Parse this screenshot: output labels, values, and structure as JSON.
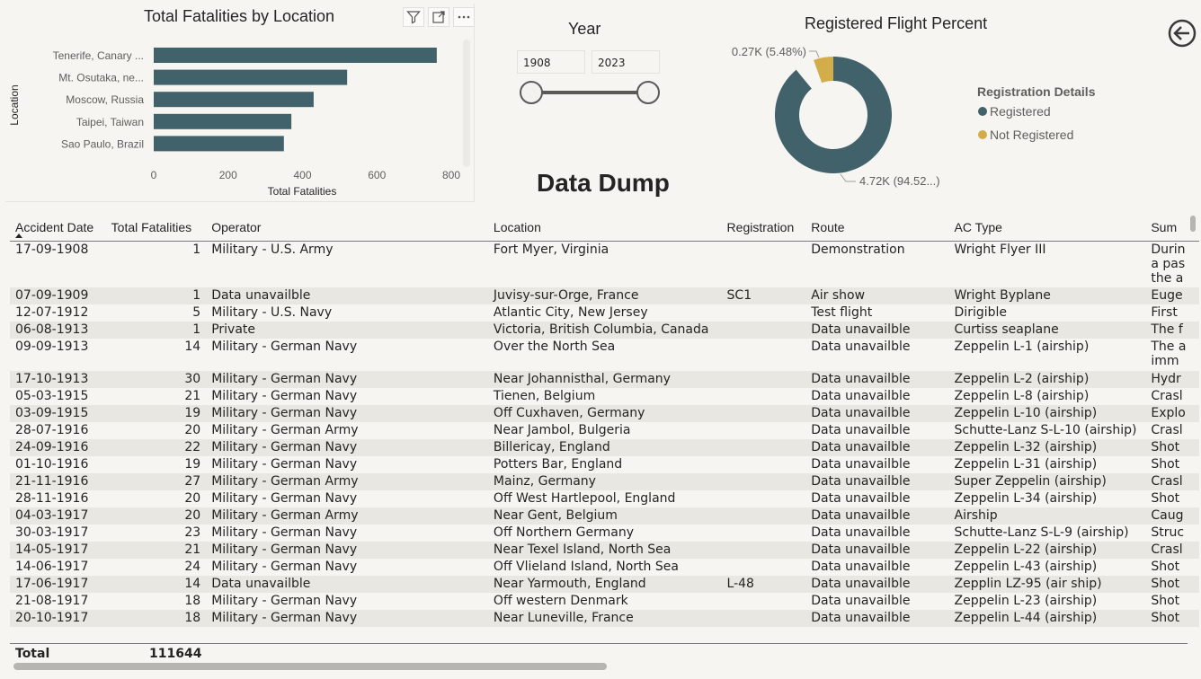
{
  "bar_visual": {
    "title": "Total Fatalities by Location",
    "header_icons": [
      "filter-icon",
      "focus-mode-icon",
      "more-options-icon"
    ]
  },
  "chart_data": {
    "type": "bar",
    "orientation": "horizontal",
    "title": "Total Fatalities by Location",
    "xlabel": "Total Fatalities",
    "ylabel": "Location",
    "categories": [
      "Tenerife, Canary ...",
      "Mt. Osutaka, ne...",
      "Moscow, Russia",
      "Taipei, Taiwan",
      "Sao Paulo, Brazil"
    ],
    "values": [
      761,
      520,
      430,
      370,
      350
    ],
    "xlim": [
      0,
      820
    ],
    "xticks": [
      "0",
      "200",
      "400",
      "600",
      "800"
    ],
    "color": "#41626b"
  },
  "year_slicer": {
    "title": "Year",
    "start": "1908",
    "end": "2023"
  },
  "page_title": "Data Dump",
  "donut": {
    "title": "Registered Flight Percent",
    "legend_title": "Registration Details",
    "slices": [
      {
        "name": "Registered",
        "fraction": 0.9452,
        "label": "4.72K (94.52...)",
        "color": "#41626b"
      },
      {
        "name": "Not Registered",
        "fraction": 0.0548,
        "label": "0.27K (5.48%)",
        "color": "#d4ad4b"
      }
    ]
  },
  "table": {
    "columns": [
      "Accident Date",
      "Total Fatalities",
      "Operator",
      "Location",
      "Registration",
      "Route",
      "AC Type",
      "Sum"
    ],
    "rows": [
      [
        "17-09-1908",
        "1",
        "Military - U.S. Army",
        "Fort Myer, Virginia",
        "",
        "Demonstration",
        "Wright Flyer III",
        "Durin a pas the a"
      ],
      [
        "07-09-1909",
        "1",
        "Data unavailble",
        "Juvisy-sur-Orge, France",
        "SC1",
        "Air show",
        "Wright Byplane",
        "Euge"
      ],
      [
        "12-07-1912",
        "5",
        "Military - U.S. Navy",
        "Atlantic City, New Jersey",
        "",
        "Test flight",
        "Dirigible",
        "First"
      ],
      [
        "06-08-1913",
        "1",
        "Private",
        "Victoria, British Columbia, Canada",
        "",
        "Data unavailble",
        "Curtiss seaplane",
        "The f"
      ],
      [
        "09-09-1913",
        "14",
        "Military - German Navy",
        "Over the North Sea",
        "",
        "Data unavailble",
        "Zeppelin L-1 (airship)",
        "The a imm"
      ],
      [
        "17-10-1913",
        "30",
        "Military - German Navy",
        "Near Johannisthal, Germany",
        "",
        "Data unavailble",
        "Zeppelin L-2 (airship)",
        "Hydr"
      ],
      [
        "05-03-1915",
        "21",
        "Military - German Navy",
        "Tienen, Belgium",
        "",
        "Data unavailble",
        "Zeppelin L-8 (airship)",
        "Crasl"
      ],
      [
        "03-09-1915",
        "19",
        "Military - German Navy",
        "Off Cuxhaven, Germany",
        "",
        "Data unavailble",
        "Zeppelin L-10 (airship)",
        "Explo"
      ],
      [
        "28-07-1916",
        "20",
        "Military - German Army",
        "Near Jambol, Bulgeria",
        "",
        "Data unavailble",
        "Schutte-Lanz S-L-10 (airship)",
        "Crasl"
      ],
      [
        "24-09-1916",
        "22",
        "Military - German Navy",
        "Billericay, England",
        "",
        "Data unavailble",
        "Zeppelin L-32 (airship)",
        "Shot"
      ],
      [
        "01-10-1916",
        "19",
        "Military - German Navy",
        "Potters Bar, England",
        "",
        "Data unavailble",
        "Zeppelin L-31 (airship)",
        "Shot"
      ],
      [
        "21-11-1916",
        "27",
        "Military - German Army",
        "Mainz, Germany",
        "",
        "Data unavailble",
        "Super Zeppelin (airship)",
        "Crasl"
      ],
      [
        "28-11-1916",
        "20",
        "Military - German Navy",
        "Off West Hartlepool, England",
        "",
        "Data unavailble",
        "Zeppelin L-34 (airship)",
        "Shot"
      ],
      [
        "04-03-1917",
        "20",
        "Military - German Army",
        "Near Gent, Belgium",
        "",
        "Data unavailble",
        "Airship",
        "Caug"
      ],
      [
        "30-03-1917",
        "23",
        "Military - German Navy",
        "Off Northern Germany",
        "",
        "Data unavailble",
        "Schutte-Lanz S-L-9 (airship)",
        "Struc"
      ],
      [
        "14-05-1917",
        "21",
        "Military - German Navy",
        "Near Texel Island, North Sea",
        "",
        "Data unavailble",
        "Zeppelin L-22 (airship)",
        "Crasl"
      ],
      [
        "14-06-1917",
        "24",
        "Military - German Navy",
        "Off Vlieland Island, North Sea",
        "",
        "Data unavailble",
        "Zeppelin L-43 (airship)",
        "Shot"
      ],
      [
        "17-06-1917",
        "14",
        "Data unavailble",
        "Near Yarmouth, England",
        "L-48",
        "Data unavailble",
        "Zepplin LZ-95 (air ship)",
        "Shot"
      ],
      [
        "21-08-1917",
        "18",
        "Military - German Navy",
        "Off western Denmark",
        "",
        "Data unavailble",
        "Zeppelin L-23 (airship)",
        "Shot"
      ],
      [
        "20-10-1917",
        "18",
        "Military - German Navy",
        "Near Luneville, France",
        "",
        "Data unavailble",
        "Zeppelin L-44 (airship)",
        "Shot"
      ]
    ],
    "total_label": "Total",
    "total_value": "111644"
  }
}
